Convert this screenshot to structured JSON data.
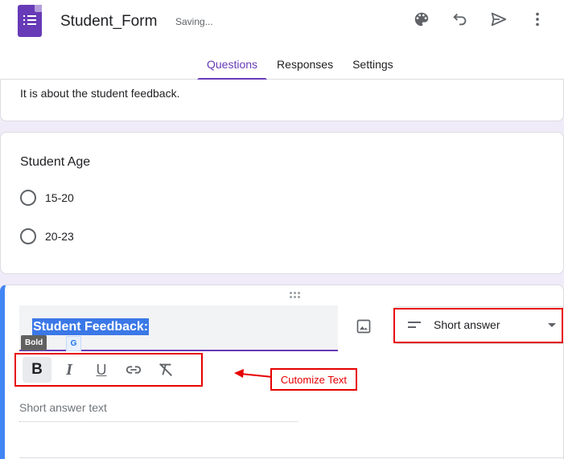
{
  "header": {
    "title": "Student_Form",
    "save_status": "Saving...",
    "icons": [
      "palette-icon",
      "undo-icon",
      "send-icon",
      "more-vert-icon"
    ]
  },
  "tabs": [
    {
      "label": "Questions",
      "active": true
    },
    {
      "label": "Responses",
      "active": false
    },
    {
      "label": "Settings",
      "active": false
    }
  ],
  "description": "It is about the student feedback.",
  "question_age": {
    "title": "Student Age",
    "options": [
      "15-20",
      "20-23"
    ]
  },
  "active_question": {
    "title": "Student Feedback:",
    "tooltip": "Bold",
    "badge": "G",
    "type": "Short answer",
    "answer_placeholder": "Short answer text"
  },
  "toolbar": {
    "bold": "B",
    "italic": "I",
    "underline": "U"
  },
  "annotation": {
    "callout": "Cutomize Text",
    "color": "#e60000"
  },
  "colors": {
    "accent": "#673ab7",
    "background": "#f0ebf8",
    "active_border": "#4285f4"
  }
}
